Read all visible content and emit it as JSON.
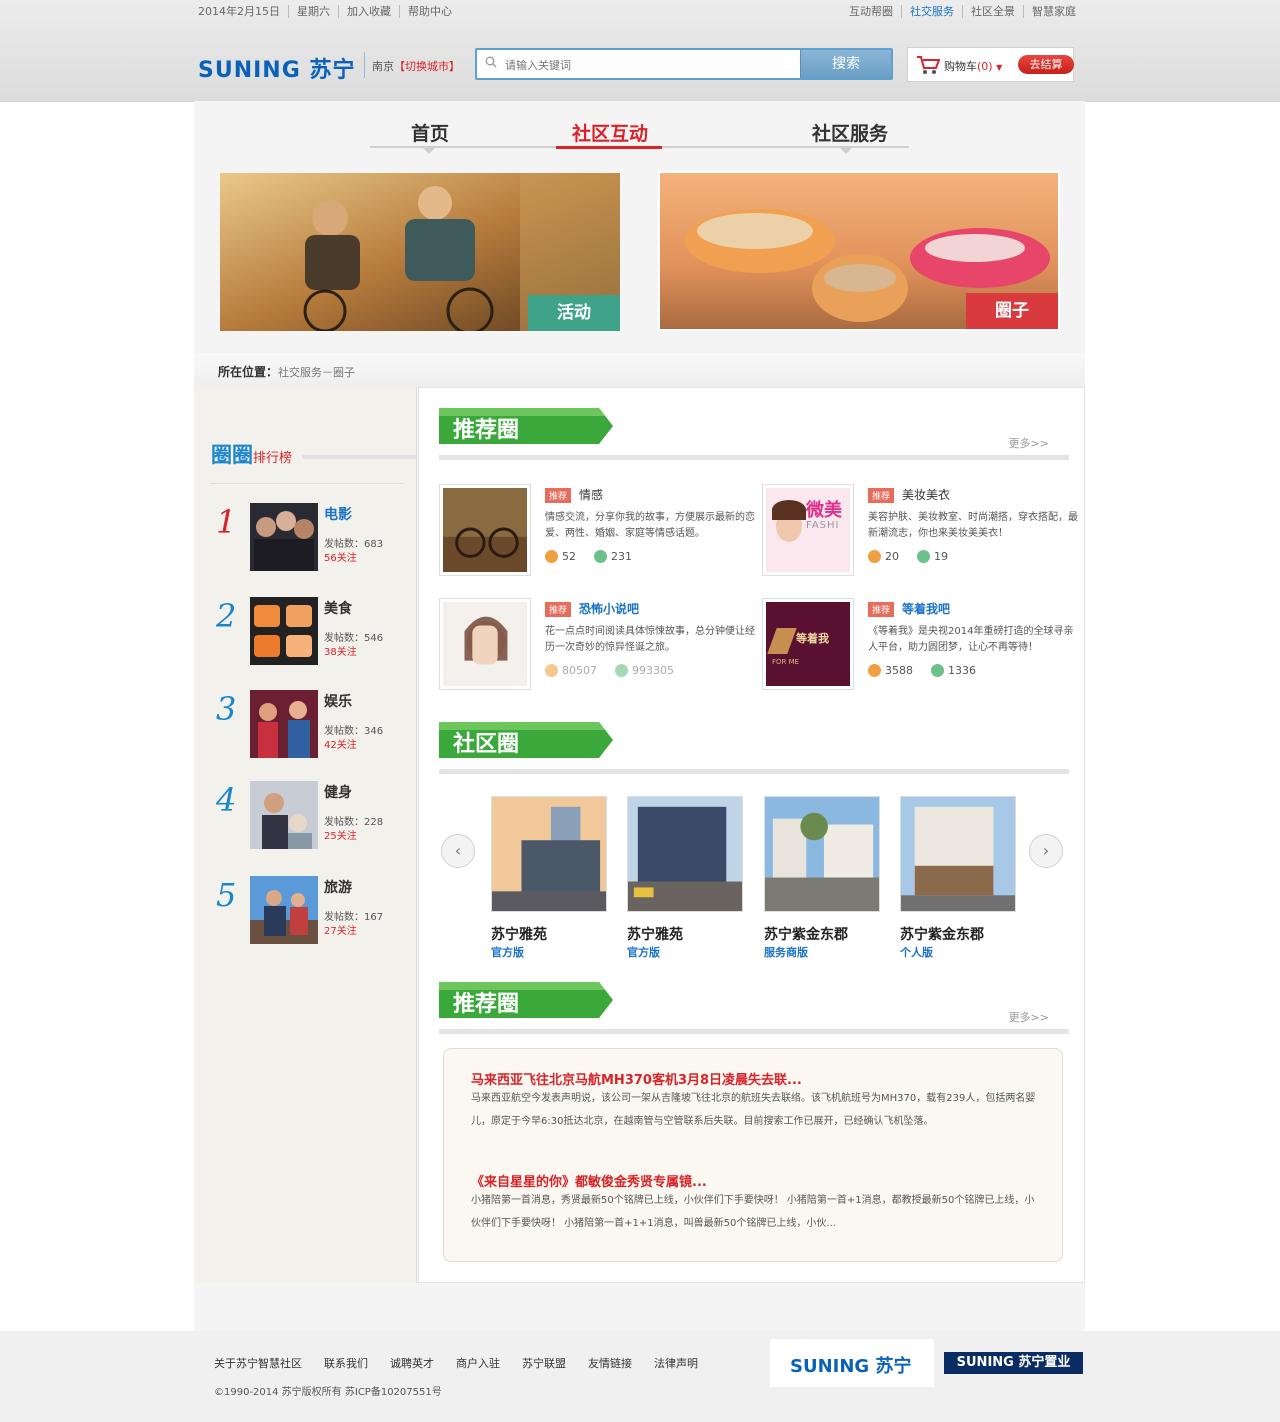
{
  "topbar": {
    "left": [
      "2014年2月15日",
      "星期六",
      "加入收藏",
      "帮助中心"
    ],
    "right": [
      "互动帮圈",
      "社交服务",
      "社区全景",
      "智慧家庭"
    ]
  },
  "header": {
    "logo_en": "SUNING",
    "logo_cn": "苏宁",
    "city": "南京",
    "city_switch": "【切换城市】",
    "search_placeholder": "请输入关键词",
    "search_button": "搜索",
    "cart_label": "购物车",
    "cart_count": "(0)",
    "checkout_label": "去结算"
  },
  "nav": {
    "items": [
      "首页",
      "社区互动",
      "社区服务"
    ],
    "active": "社区互动"
  },
  "banners": [
    {
      "tag": "活动",
      "tag_color": "#3fa38a"
    },
    {
      "tag": "圈子",
      "tag_color": "#d93a3d"
    }
  ],
  "breadcrumb": {
    "label": "所在位置：",
    "path": "社交服务－圈子"
  },
  "ranking": {
    "title": "圈圈",
    "subtitle": "排行榜",
    "items": [
      {
        "rank": "1",
        "name": "电影",
        "posts": "发帖数：683",
        "follows": "56关注",
        "color": "#d8232a"
      },
      {
        "rank": "2",
        "name": "美食",
        "posts": "发帖数：546",
        "follows": "38关注",
        "color": "#1a86cc"
      },
      {
        "rank": "3",
        "name": "娱乐",
        "posts": "发帖数：346",
        "follows": "42关注",
        "color": "#1a86cc"
      },
      {
        "rank": "4",
        "name": "健身",
        "posts": "发帖数：228",
        "follows": "25关注",
        "color": "#1a86cc"
      },
      {
        "rank": "5",
        "name": "旅游",
        "posts": "发帖数：167",
        "follows": "27关注",
        "color": "#1a86cc"
      }
    ]
  },
  "recommend": {
    "title": "推荐圈",
    "more": "更多>>",
    "cards": [
      {
        "tag": "推荐",
        "title": "情感",
        "desc": "情感交流，分享你我的故事，方便展示最新的恋爱、两性、婚姻、家庭等情感话题。",
        "users": "52",
        "posts": "231"
      },
      {
        "tag": "推荐",
        "title": "美妆美衣",
        "desc": "美容护肤、美妆教室、时尚潮搭，穿衣搭配，最新潮流志，你也来美妆美美衣！",
        "users": "20",
        "posts": "19"
      },
      {
        "tag": "推荐",
        "title": "恐怖小说吧",
        "desc": "花一点点时间阅读具体惊悚故事，总分钟便让经历一次奇妙的惊异怪诞之旅。",
        "users": "80507",
        "posts": "993305"
      },
      {
        "tag": "推荐",
        "title": "等着我吧",
        "desc": "《等着我》是央视2014年重磅打造的全球寻亲人平台，助力圆团梦，让心不再等待！",
        "users": "3588",
        "posts": "1336"
      }
    ],
    "image_texts": [
      "微美",
      "FASHI",
      "等着我",
      "FOR ME"
    ]
  },
  "community": {
    "title": "社区圈",
    "items": [
      {
        "name": "苏宁雅苑",
        "type": "官方版"
      },
      {
        "name": "苏宁雅苑",
        "type": "官方版"
      },
      {
        "name": "苏宁紫金东郡",
        "type": "服务商版"
      },
      {
        "name": "苏宁紫金东郡",
        "type": "个人版"
      }
    ]
  },
  "recommend2": {
    "title": "推荐圈",
    "more": "更多>>",
    "news": [
      {
        "title": "马来西亚飞往北京马航MH370客机3月8日凌晨失去联...",
        "body": "马来西亚航空今发表声明说，该公司一架从吉隆坡飞往北京的航班失去联络。该飞机航班号为MH370，载有239人，包括两名婴儿，原定于今早6:30抵达北京，在越南管与空管联系后失联。目前搜索工作已展开，已经确认飞机坠落。"
      },
      {
        "title": "《来自星星的你》都敏俊金秀贤专属镜...",
        "body": "小猪陪第一首消息，秀贤最新50个铭牌已上线，小伙伴们下手要快呀！ 小猪陪第一首+1消息，都教授最新50个铭牌已上线，小伙伴们下手要快呀！ 小猪陪第一首+1+1消息，叫兽最新50个铭牌已上线，小伙..."
      }
    ]
  },
  "footer": {
    "links": [
      "关于苏宁智慧社区",
      "联系我们",
      "诚聘英才",
      "商户入驻",
      "苏宁联盟",
      "友情链接",
      "法律声明"
    ],
    "copyright": "©1990-2014 苏宁版权所有  苏ICP备10207551号",
    "logo1": "SUNING 苏宁",
    "logo2": "SUNING 苏宁置业"
  },
  "colors": {
    "brand_blue": "#0a62b8",
    "accent_red": "#d8232a",
    "ribbon_green": "#3aa83a"
  }
}
